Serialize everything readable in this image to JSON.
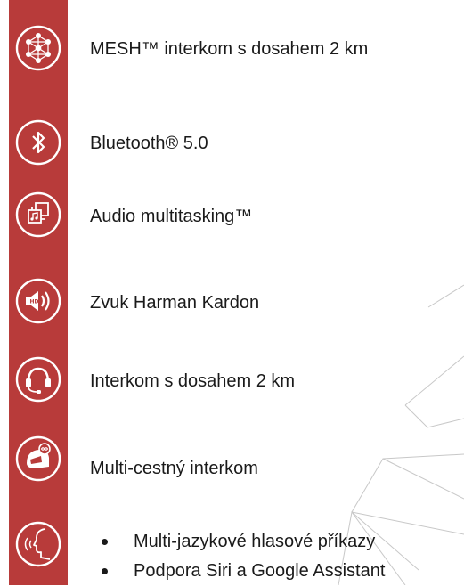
{
  "features": [
    {
      "icon": "mesh-network-icon",
      "label": "MESH™ interkom s dosahem 2 km"
    },
    {
      "icon": "bluetooth-icon",
      "label": "Bluetooth® 5.0"
    },
    {
      "icon": "audio-multitasking-icon",
      "label": "Audio multitasking™"
    },
    {
      "icon": "hd-speaker-icon",
      "label": "Zvuk Harman Kardon"
    },
    {
      "icon": "headset-icon",
      "label": "Interkom s dosahem 2 km"
    },
    {
      "icon": "helmet-infinity-icon",
      "label": "Multi-cestný interkom"
    }
  ],
  "voice": {
    "icon": "voice-command-icon",
    "bullets": [
      "Multi-jazykové hlasové příkazy",
      "Podpora Siri a Google Assistant"
    ]
  },
  "colors": {
    "sidebar": "#b83b3a",
    "icon": "#ffffff",
    "text": "#1a1a1a",
    "decoration": "#c8c8c8"
  }
}
